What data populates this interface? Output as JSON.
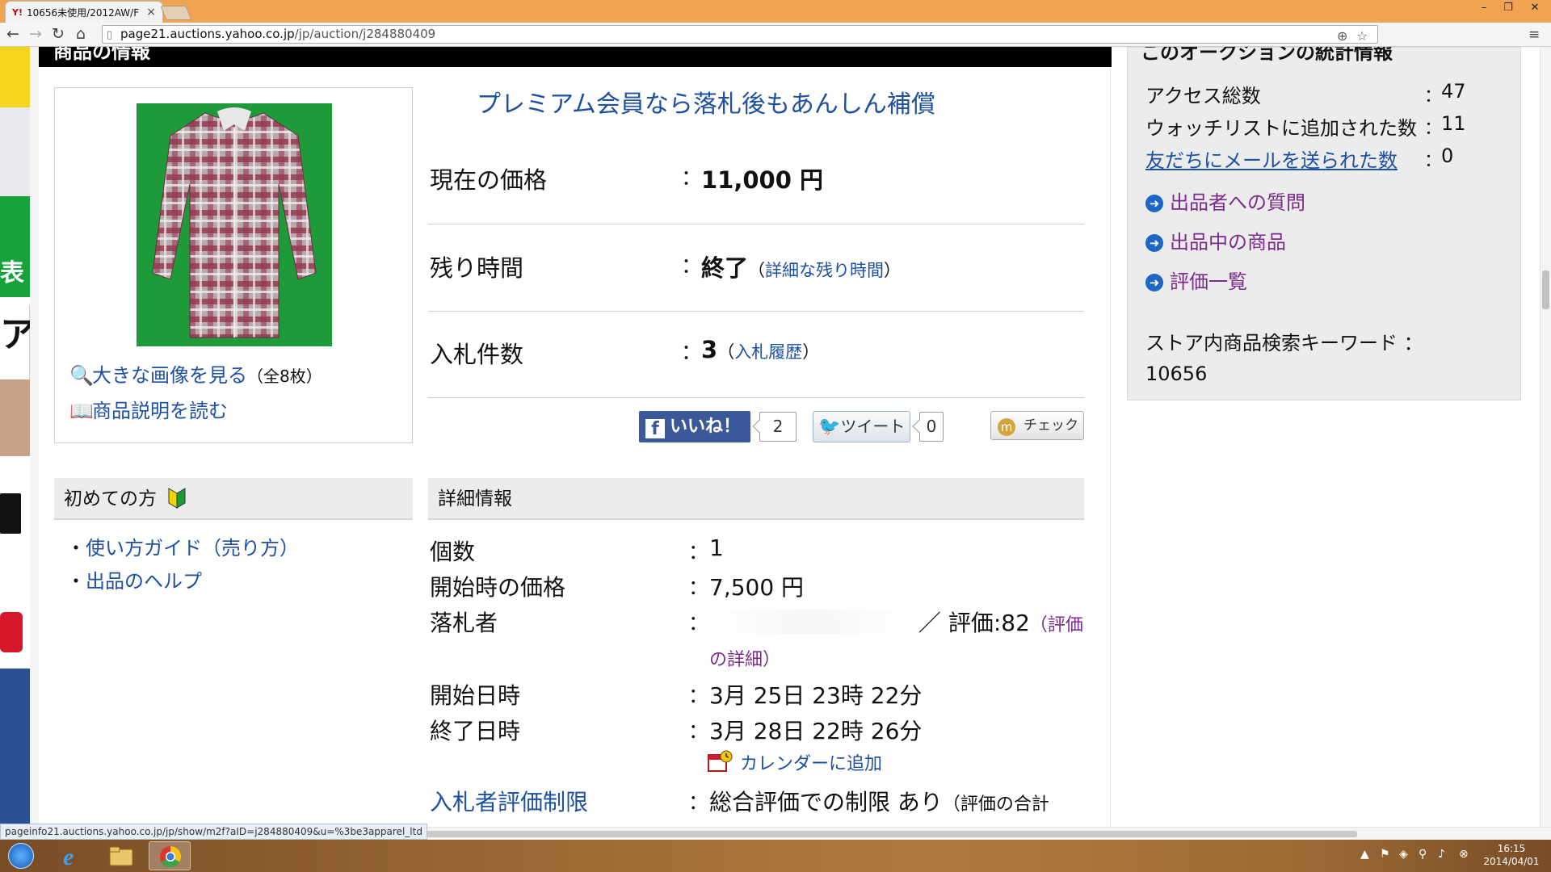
{
  "browser": {
    "tab_title": "10656未使用/2012AW/F",
    "tab_favicon": "Y!",
    "url_host": "page21.auctions.yahoo.co.jp",
    "url_path": "/jp/auction/j284880409",
    "status_url": "pageinfo21.auctions.yahoo.co.jp/jp/show/m2f?aID=j284880409&u=%3be3apparel_ltd"
  },
  "section_title": "商品の情報",
  "thumb": {
    "view_large": "大きな画像を見る",
    "count": "（全8枚）",
    "read_desc": "商品説明を読む"
  },
  "premium_banner": "プレミアム会員なら落札後もあんしん補償",
  "price": {
    "label": "現在の価格",
    "colon": "：",
    "value": "11,000 円"
  },
  "time_left": {
    "label": "残り時間",
    "colon": "：",
    "value": "終了",
    "detail_open": "（",
    "detail_link": "詳細な残り時間",
    "detail_close": "）"
  },
  "bids": {
    "label": "入札件数",
    "colon": "：",
    "value": "3",
    "history_open": "（",
    "history_link": "入札履歴",
    "history_close": "）"
  },
  "social": {
    "like_label": "いいね！",
    "like_count": "2",
    "tweet_label": "ツイート",
    "tweet_count": "0",
    "mixi_label": "チェック"
  },
  "beginner": {
    "title": "初めての方",
    "items": [
      "使い方ガイド（売り方）",
      "出品のヘルプ"
    ]
  },
  "detail": {
    "title": "詳細情報",
    "quantity_label": "個数",
    "quantity_value": "1",
    "start_price_label": "開始時の価格",
    "start_price_value": "7,500 円",
    "winner_label": "落札者",
    "winner_rating_sep": "／",
    "winner_rating_label": "評価",
    "winner_rating_value": ":82",
    "winner_rating_link_a": "（評価",
    "winner_rating_link_b": "の詳細",
    "winner_rating_link_close": "）",
    "start_label": "開始日時",
    "start_value": "3月 25日 23時 22分",
    "end_label": "終了日時",
    "end_value": "3月 28日 22時 26分",
    "calendar_link": "カレンダーに追加",
    "restriction_label": "入札者評価制限",
    "restriction_value": "総合評価での制限 あり",
    "restriction_note": "（評価の合計",
    "colon": "："
  },
  "stats": {
    "heading": "このオークションの統計情報",
    "access_label": "アクセス総数",
    "access_value": "47",
    "watch_label": "ウォッチリストに追加された数",
    "watch_value": "11",
    "mail_label": "友だちにメールを送られた数",
    "mail_value": "0",
    "colon": "：",
    "links": [
      "出品者への質問",
      "出品中の商品",
      "評価一覧"
    ],
    "keyword_label": "ストア内商品検索キーワード",
    "keyword_value": "10656"
  },
  "taskbar": {
    "time": "16:15",
    "date": "2014/04/01"
  },
  "colors": {
    "link": "#1d4fa3",
    "visited": "#7a2b8c",
    "facebook": "#3b5998",
    "header_bar": "#000000",
    "panel_bg": "#ececec",
    "titlebar": "#f0a451"
  }
}
